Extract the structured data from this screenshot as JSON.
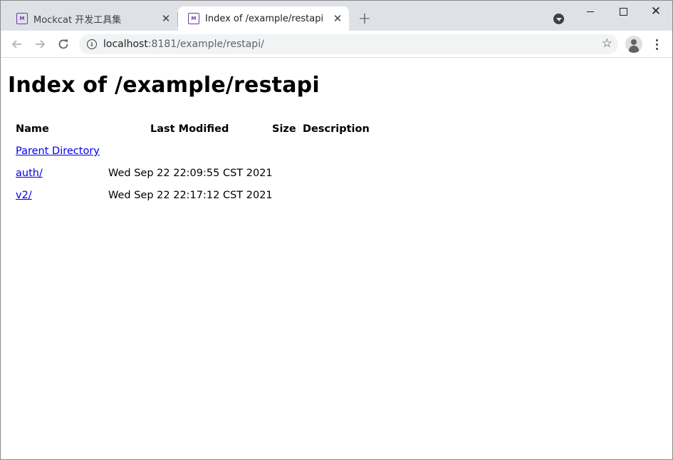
{
  "browser": {
    "tabs": [
      {
        "title": "Mockcat 开发工具集",
        "favicon": "mockcat-logo-icon",
        "active": false
      },
      {
        "title": "Index of /example/restapi",
        "favicon": "mockcat-logo-icon",
        "active": true
      }
    ],
    "favicon_text": "M",
    "close_glyph": "✕",
    "new_tab_glyph": "+",
    "window_close_glyph": "✕",
    "address": {
      "host": "localhost",
      "path": ":8181/example/restapi/"
    }
  },
  "page": {
    "heading": "Index of /example/restapi",
    "columns": {
      "name": "Name",
      "modified": "Last Modified",
      "size": "Size",
      "description": "Description"
    },
    "rows": [
      {
        "name": "Parent Directory",
        "modified": "",
        "size": "",
        "description": ""
      },
      {
        "name": "auth/",
        "modified": "Wed Sep 22 22:09:55 CST 2021",
        "size": "",
        "description": ""
      },
      {
        "name": "v2/",
        "modified": "Wed Sep 22 22:17:12 CST 2021",
        "size": "",
        "description": ""
      }
    ]
  },
  "colors": {
    "tabstrip": "#dee1e6",
    "link": "#0000ee",
    "accent": "#6a3ab2"
  }
}
